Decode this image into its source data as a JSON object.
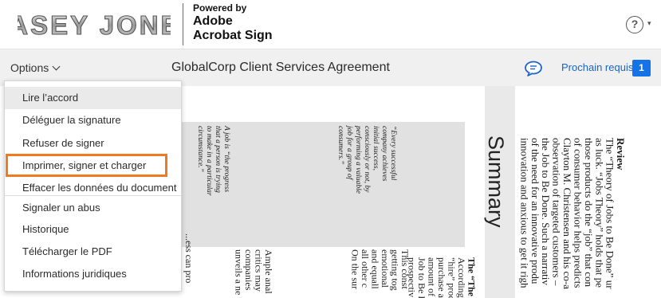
{
  "header": {
    "logo_text": "CASEY JONES",
    "powered_line1": "Powered by",
    "powered_line2": "Adobe",
    "powered_line3": "Acrobat Sign",
    "help_symbol": "?",
    "help_caret": "▾"
  },
  "toolbar": {
    "options_label": "Options",
    "document_title": "GlobalCorp Client Services Agreement",
    "next_required_label": "Prochain requis",
    "next_required_count": "1",
    "accent_color": "#1473e6"
  },
  "menu": {
    "items": [
      {
        "label": "Lire l’accord"
      },
      {
        "label": "Déléguer la signature"
      },
      {
        "label": "Refuser de signer"
      },
      {
        "label": "Imprimer, signer et charger"
      },
      {
        "label": "Effacer les données du document"
      },
      {
        "label": "Signaler un abus"
      },
      {
        "label": "Historique"
      },
      {
        "label": "Télécharger le PDF"
      },
      {
        "label": "Informations juridiques"
      }
    ],
    "highlight_color": "#ee7b22"
  },
  "document": {
    "quote1": [
      "A job is “the progress",
      "that a person is trying",
      "to make in a particular",
      "circumstance.”"
    ],
    "quote2": [
      "“Every successful",
      "company achieves",
      "initial success,",
      "consciously or not, by",
      "performing a valuable",
      "job for a group of",
      "consumers.”"
    ],
    "col_a": [
      "...ess can pro"
    ],
    "col_b": [
      "Ample anal",
      "critics may",
      "companies",
      "unveils a ne"
    ],
    "col_c": [
      "This const",
      "getting tog",
      "emotional",
      "and equall",
      "all other c",
      "On the sur"
    ],
    "col_d": [
      "The “The",
      "According",
      "“hire” proc",
      "purchase a",
      "amount of",
      "Job to Be D",
      "prospectiv"
    ],
    "summary_heading": "Summary",
    "review": [
      "Review",
      "The “Theory of Jobs to Be Done” ur",
      "as luck. “Jobs Theory” holds that pe",
      "those products do the “job” that con",
      "of consumer behavior helps predicts",
      "Clayton M. Christensen and his co-a",
      "observation of targeted customers –",
      "the Job to Be Done. Such a narrativ",
      "of the need for an innovative produ",
      "innovation and anxious to get it righ"
    ]
  }
}
